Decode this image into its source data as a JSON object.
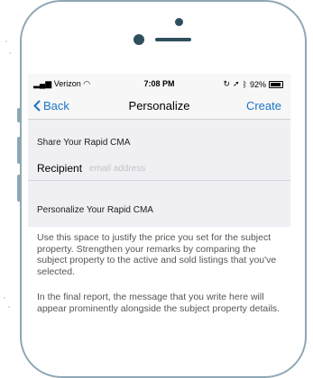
{
  "status_bar": {
    "carrier": "Verizon",
    "time": "7:08 PM",
    "battery": "92%",
    "battery_level": 0.92
  },
  "nav": {
    "back_label": "Back",
    "title": "Personalize",
    "create_label": "Create"
  },
  "share_section": {
    "header": "Share Your Rapid CMA",
    "recipient_label": "Recipient",
    "recipient_placeholder": "email address",
    "recipient_value": ""
  },
  "personalize_section": {
    "header": "Personalize Your Rapid CMA",
    "paragraphs": [
      "Use this space to justify the price you set for the subject property. Strengthen your remarks by comparing the subject property to the active and sold listings that you've selected.",
      "In the final report, the message that you write here will appear prominently alongside the subject property details."
    ]
  },
  "colors": {
    "accent": "#1a73c8",
    "phone_frame": "#8fa7b4",
    "screen_bg": "#efeff4"
  }
}
